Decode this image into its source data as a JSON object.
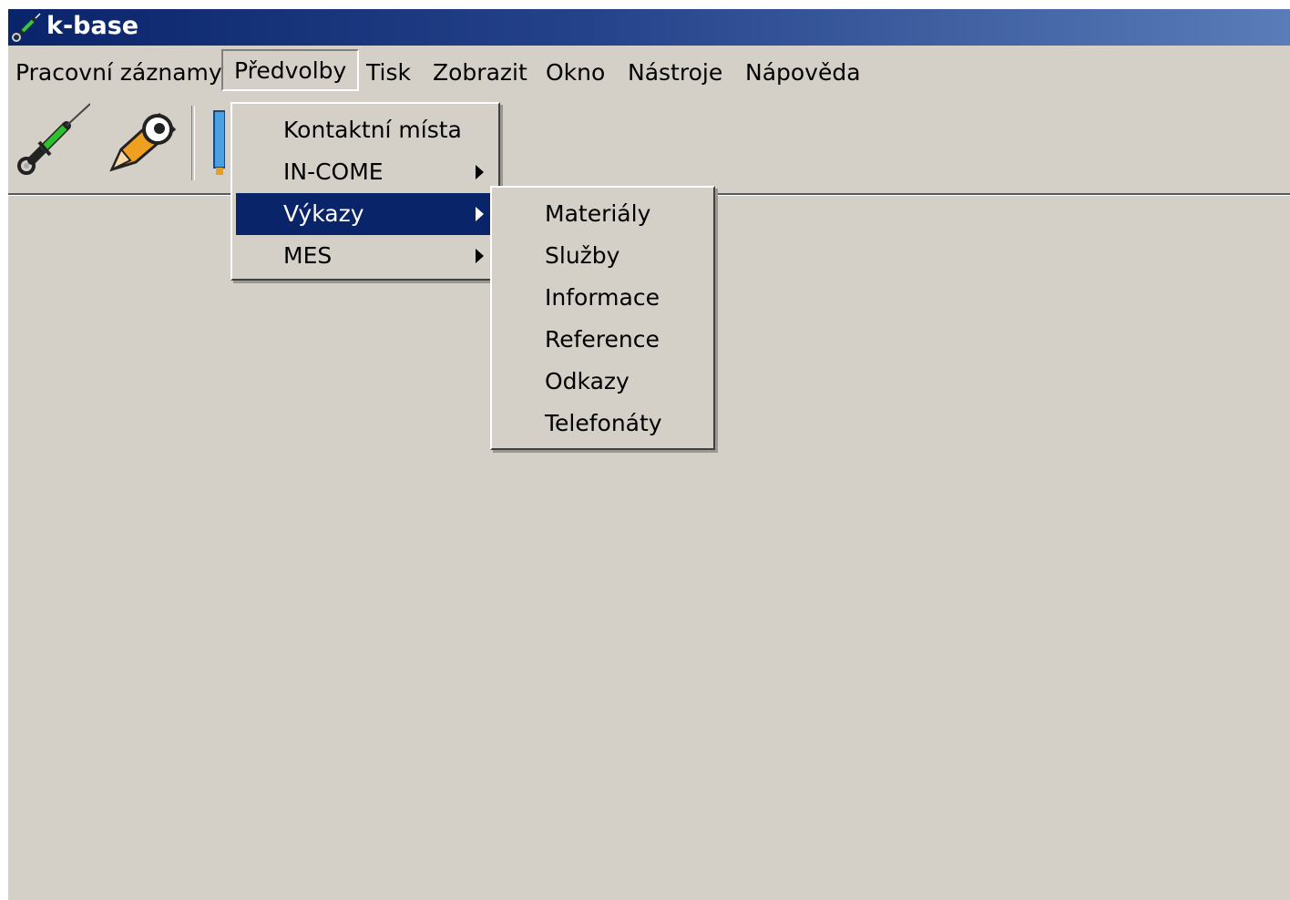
{
  "window": {
    "title": "k-base"
  },
  "menubar": {
    "items": [
      {
        "label": "Pracovní záznamy"
      },
      {
        "label": "Předvolby"
      },
      {
        "label": "Tisk"
      },
      {
        "label": "Zobrazit"
      },
      {
        "label": "Okno"
      },
      {
        "label": "Nástroje"
      },
      {
        "label": "Nápověda"
      }
    ],
    "open_item": "Předvolby"
  },
  "toolbar": {
    "buttons": [
      {
        "icon": "syringe-icon"
      },
      {
        "icon": "pencil-icon"
      },
      {
        "icon": "document-icon"
      }
    ]
  },
  "predvolby_menu": {
    "items": [
      {
        "label": "Kontaktní místa",
        "has_submenu": false
      },
      {
        "label": "IN-COME",
        "has_submenu": true
      },
      {
        "label": "Výkazy",
        "has_submenu": true,
        "highlighted": true
      },
      {
        "label": "MES",
        "has_submenu": true
      }
    ]
  },
  "vykazy_submenu": {
    "items": [
      {
        "label": "Materiály"
      },
      {
        "label": "Služby"
      },
      {
        "label": "Informace"
      },
      {
        "label": "Reference"
      },
      {
        "label": "Odkazy"
      },
      {
        "label": "Telefonáty"
      }
    ]
  },
  "colors": {
    "face": "#d4d0c8",
    "titlebar_start": "#0a246a",
    "titlebar_end": "#5a7cb8",
    "highlight": "#0a246a"
  }
}
